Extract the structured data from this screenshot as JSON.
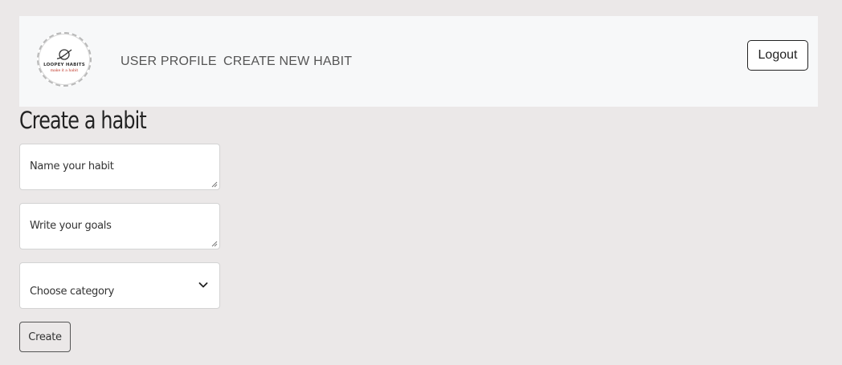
{
  "navbar": {
    "logo": {
      "title": "LOOPEY HABITS",
      "tagline": "make it a habit",
      "icon": "planet-icon"
    },
    "links": [
      {
        "label": "USER PROFILE"
      },
      {
        "label": "CREATE NEW HABIT"
      }
    ],
    "logout_label": "Logout"
  },
  "page": {
    "title": "Create a habit"
  },
  "form": {
    "name_placeholder": "Name your habit",
    "goals_placeholder": "Write your goals",
    "category_selected": "Choose category",
    "submit_label": "Create"
  },
  "colors": {
    "background": "#ebe8e8",
    "navbar": "#f7f8f9",
    "logo_tagline": "#c0392b"
  }
}
